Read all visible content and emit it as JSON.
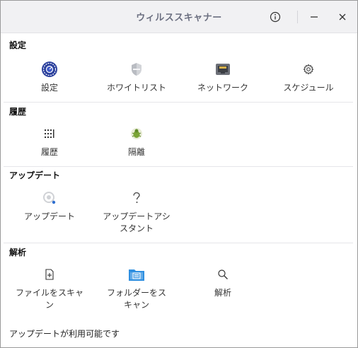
{
  "window": {
    "title": "ウィルススキャナー"
  },
  "sections": {
    "settings": {
      "title": "設定",
      "items": [
        "設定",
        "ホワイトリスト",
        "ネットワーク",
        "スケジュール"
      ]
    },
    "history": {
      "title": "履歴",
      "items": [
        "履歴",
        "隔離"
      ]
    },
    "update": {
      "title": "アップデート",
      "items": [
        "アップデート",
        "アップデートアシ\nスタント"
      ]
    },
    "analysis": {
      "title": "解析",
      "items": [
        "ファイルをスキャ\nン",
        "フォルダーをス\nキャン",
        "解析"
      ]
    }
  },
  "status": "アップデートが利用可能です",
  "colors": {
    "accent": "#2f6fd0",
    "title": "#6b6f80",
    "update_dot": "#2f6fd0"
  }
}
